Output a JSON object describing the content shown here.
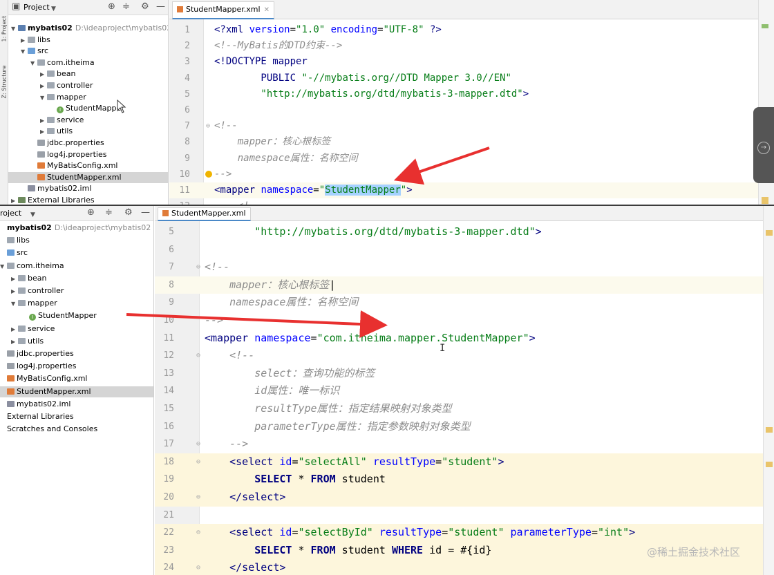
{
  "top": {
    "toolstrip": {
      "project_label": "1: Project",
      "structure_label": "Z: Structure"
    },
    "panel": {
      "title": "Project",
      "tree": [
        {
          "label": "mybatis02",
          "path": "D:\\ideaproject\\mybatis02",
          "depth": 0,
          "arrow": "▼",
          "icon": "module",
          "bold": true
        },
        {
          "label": "libs",
          "depth": 1,
          "arrow": "▶",
          "icon": "folder"
        },
        {
          "label": "src",
          "depth": 1,
          "arrow": "▼",
          "icon": "folder-src"
        },
        {
          "label": "com.itheima",
          "depth": 2,
          "arrow": "▼",
          "icon": "folder"
        },
        {
          "label": "bean",
          "depth": 3,
          "arrow": "▶",
          "icon": "folder"
        },
        {
          "label": "controller",
          "depth": 3,
          "arrow": "▶",
          "icon": "folder"
        },
        {
          "label": "mapper",
          "depth": 3,
          "arrow": "▼",
          "icon": "folder"
        },
        {
          "label": "StudentMapper",
          "depth": 4,
          "arrow": "",
          "icon": "iface"
        },
        {
          "label": "service",
          "depth": 3,
          "arrow": "▶",
          "icon": "folder"
        },
        {
          "label": "utils",
          "depth": 3,
          "arrow": "▶",
          "icon": "folder"
        },
        {
          "label": "jdbc.properties",
          "depth": 2,
          "arrow": "",
          "icon": "props"
        },
        {
          "label": "log4j.properties",
          "depth": 2,
          "arrow": "",
          "icon": "props"
        },
        {
          "label": "MyBatisConfig.xml",
          "depth": 2,
          "arrow": "",
          "icon": "xml"
        },
        {
          "label": "StudentMapper.xml",
          "depth": 2,
          "arrow": "",
          "icon": "xml",
          "selected": true
        },
        {
          "label": "mybatis02.iml",
          "depth": 1,
          "arrow": "",
          "icon": "iml"
        },
        {
          "label": "External Libraries",
          "depth": 0,
          "arrow": "▶",
          "icon": "libs"
        }
      ]
    },
    "tab": {
      "label": "StudentMapper.xml"
    },
    "lines": [
      {
        "n": "1",
        "fold": "",
        "tokens": [
          [
            "tg",
            "<?xml "
          ],
          [
            "at",
            "version"
          ],
          [
            "tx",
            "="
          ],
          [
            "st",
            "\"1.0\""
          ],
          [
            "tx",
            " "
          ],
          [
            "at",
            "encoding"
          ],
          [
            "tx",
            "="
          ],
          [
            "st",
            "\"UTF-8\""
          ],
          [
            "tx",
            " "
          ],
          [
            "tg",
            "?>"
          ]
        ]
      },
      {
        "n": "2",
        "fold": "",
        "tokens": [
          [
            "cm",
            "<!--MyBatis的DTD约束-->"
          ]
        ]
      },
      {
        "n": "3",
        "fold": "",
        "tokens": [
          [
            "tg",
            "<!DOCTYPE mapper"
          ]
        ]
      },
      {
        "n": "4",
        "fold": "",
        "tokens": [
          [
            "tg",
            "        PUBLIC "
          ],
          [
            "st",
            "\"-//mybatis.org//DTD Mapper 3.0//EN\""
          ]
        ]
      },
      {
        "n": "5",
        "fold": "",
        "tokens": [
          [
            "st",
            "        \"http://mybatis.org/dtd/mybatis-3-mapper.dtd\""
          ],
          [
            "tg",
            ">"
          ]
        ]
      },
      {
        "n": "6",
        "fold": "",
        "tokens": []
      },
      {
        "n": "7",
        "fold": "⊖",
        "tokens": [
          [
            "cm",
            "<!--"
          ]
        ]
      },
      {
        "n": "8",
        "fold": "",
        "tokens": [
          [
            "cm",
            "    mapper：核心根标签"
          ]
        ]
      },
      {
        "n": "9",
        "fold": "",
        "tokens": [
          [
            "cm",
            "    namespace属性：名称空间"
          ]
        ]
      },
      {
        "n": "10",
        "fold": "",
        "bulb": true,
        "tokens": [
          [
            "cm",
            "-->"
          ]
        ]
      },
      {
        "n": "11",
        "fold": "",
        "cur": true,
        "tokens": [
          [
            "tg",
            "<mapper "
          ],
          [
            "at",
            "namespace"
          ],
          [
            "tx",
            "="
          ],
          [
            "st",
            "\""
          ],
          [
            "sel",
            "StudentMapper"
          ],
          [
            "st",
            "\""
          ],
          [
            "tg",
            ">"
          ]
        ]
      },
      {
        "n": "12",
        "fold": "",
        "tokens": [
          [
            "cm",
            "    <!--"
          ]
        ]
      }
    ]
  },
  "bottom": {
    "panel": {
      "title": "roject",
      "tree": [
        {
          "label": "mybatis02",
          "path": "D:\\ideaproject\\mybatis02",
          "depth": 0,
          "arrow": "",
          "icon": "",
          "bold": true
        },
        {
          "label": "libs",
          "depth": 0,
          "arrow": "",
          "icon": "folder"
        },
        {
          "label": "src",
          "depth": 0,
          "arrow": "",
          "icon": "folder-src"
        },
        {
          "label": "com.itheima",
          "depth": 0,
          "arrow": "▼",
          "icon": "folder"
        },
        {
          "label": "bean",
          "depth": 1,
          "arrow": "▶",
          "icon": "folder"
        },
        {
          "label": "controller",
          "depth": 1,
          "arrow": "▶",
          "icon": "folder"
        },
        {
          "label": "mapper",
          "depth": 1,
          "arrow": "▼",
          "icon": "folder"
        },
        {
          "label": "StudentMapper",
          "depth": 2,
          "arrow": "",
          "icon": "iface"
        },
        {
          "label": "service",
          "depth": 1,
          "arrow": "▶",
          "icon": "folder"
        },
        {
          "label": "utils",
          "depth": 1,
          "arrow": "▶",
          "icon": "folder"
        },
        {
          "label": "jdbc.properties",
          "depth": 0,
          "arrow": "",
          "icon": "props"
        },
        {
          "label": "log4j.properties",
          "depth": 0,
          "arrow": "",
          "icon": "props"
        },
        {
          "label": "MyBatisConfig.xml",
          "depth": 0,
          "arrow": "",
          "icon": "xml"
        },
        {
          "label": "StudentMapper.xml",
          "depth": 0,
          "arrow": "",
          "icon": "xml",
          "selected": true
        },
        {
          "label": "mybatis02.iml",
          "depth": 0,
          "arrow": "",
          "icon": "iml"
        },
        {
          "label": "External Libraries",
          "depth": 0,
          "arrow": "",
          "icon": ""
        },
        {
          "label": "Scratches and Consoles",
          "depth": 0,
          "arrow": "",
          "icon": ""
        }
      ]
    },
    "tab": {
      "label": "StudentMapper.xml"
    },
    "lines": [
      {
        "n": "5",
        "fold": "",
        "tokens": [
          [
            "st",
            "        \"http://mybatis.org/dtd/mybatis-3-mapper.dtd\""
          ],
          [
            "tg",
            ">"
          ]
        ]
      },
      {
        "n": "6",
        "fold": "",
        "tokens": []
      },
      {
        "n": "7",
        "fold": "⊖",
        "tokens": [
          [
            "cm",
            "<!--"
          ]
        ]
      },
      {
        "n": "8",
        "fold": "",
        "cur": true,
        "tokens": [
          [
            "cm",
            "    mapper：核心根标签"
          ],
          [
            "tx",
            "|"
          ]
        ]
      },
      {
        "n": "9",
        "fold": "",
        "tokens": [
          [
            "cm",
            "    namespace属性：名称空间"
          ]
        ]
      },
      {
        "n": "10",
        "fold": "",
        "tokens": [
          [
            "cm",
            "-->"
          ]
        ]
      },
      {
        "n": "11",
        "fold": "",
        "tokens": [
          [
            "tg",
            "<mapper "
          ],
          [
            "at",
            "namespace"
          ],
          [
            "tx",
            "="
          ],
          [
            "st",
            "\"com.itheima.mapper.StudentMapper\""
          ],
          [
            "tg",
            ">"
          ]
        ]
      },
      {
        "n": "12",
        "fold": "⊖",
        "tokens": [
          [
            "cm",
            "    <!--"
          ]
        ]
      },
      {
        "n": "13",
        "fold": "",
        "tokens": [
          [
            "cm",
            "        select：查询功能的标签"
          ]
        ]
      },
      {
        "n": "14",
        "fold": "",
        "tokens": [
          [
            "cm",
            "        id属性：唯一标识"
          ]
        ]
      },
      {
        "n": "15",
        "fold": "",
        "tokens": [
          [
            "cm",
            "        resultType属性：指定结果映射对象类型"
          ]
        ]
      },
      {
        "n": "16",
        "fold": "",
        "tokens": [
          [
            "cm",
            "        parameterType属性：指定参数映射对象类型"
          ]
        ]
      },
      {
        "n": "17",
        "fold": "⊖",
        "tokens": [
          [
            "cm",
            "    -->"
          ]
        ]
      },
      {
        "n": "18",
        "fold": "⊖",
        "hl": true,
        "tokens": [
          [
            "tg",
            "    <select "
          ],
          [
            "at",
            "id"
          ],
          [
            "tx",
            "="
          ],
          [
            "st",
            "\"selectAll\""
          ],
          [
            "tx",
            " "
          ],
          [
            "at",
            "resultType"
          ],
          [
            "tx",
            "="
          ],
          [
            "st",
            "\"student\""
          ],
          [
            "tg",
            ">"
          ]
        ]
      },
      {
        "n": "19",
        "fold": "",
        "hl": true,
        "tokens": [
          [
            "kw",
            "        SELECT"
          ],
          [
            "tx",
            " * "
          ],
          [
            "kw",
            "FROM"
          ],
          [
            "tx",
            " student"
          ]
        ]
      },
      {
        "n": "20",
        "fold": "⊖",
        "hl": true,
        "tokens": [
          [
            "tg",
            "    </select>"
          ]
        ]
      },
      {
        "n": "21",
        "fold": "",
        "tokens": []
      },
      {
        "n": "22",
        "fold": "⊖",
        "hl": true,
        "tokens": [
          [
            "tg",
            "    <select "
          ],
          [
            "at",
            "id"
          ],
          [
            "tx",
            "="
          ],
          [
            "st",
            "\"selectById\""
          ],
          [
            "tx",
            " "
          ],
          [
            "at",
            "resultType"
          ],
          [
            "tx",
            "="
          ],
          [
            "st",
            "\"student\""
          ],
          [
            "tx",
            " "
          ],
          [
            "at",
            "parameterType"
          ],
          [
            "tx",
            "="
          ],
          [
            "st",
            "\"int\""
          ],
          [
            "tg",
            ">"
          ]
        ]
      },
      {
        "n": "23",
        "fold": "",
        "hl": true,
        "tokens": [
          [
            "kw",
            "        SELECT"
          ],
          [
            "tx",
            " * "
          ],
          [
            "kw",
            "FROM"
          ],
          [
            "tx",
            " student "
          ],
          [
            "kw",
            "WHERE"
          ],
          [
            "tx",
            " id = #{id}"
          ]
        ]
      },
      {
        "n": "24",
        "fold": "⊖",
        "hl": true,
        "tokens": [
          [
            "tg",
            "    </select>"
          ]
        ]
      }
    ]
  },
  "watermark": "@稀土掘金技术社区",
  "colors": {
    "arrow": "#e8302f",
    "selection": "#a6d2ff",
    "highlight": "#fdf6dc",
    "tab_accent": "#4a88c7"
  }
}
